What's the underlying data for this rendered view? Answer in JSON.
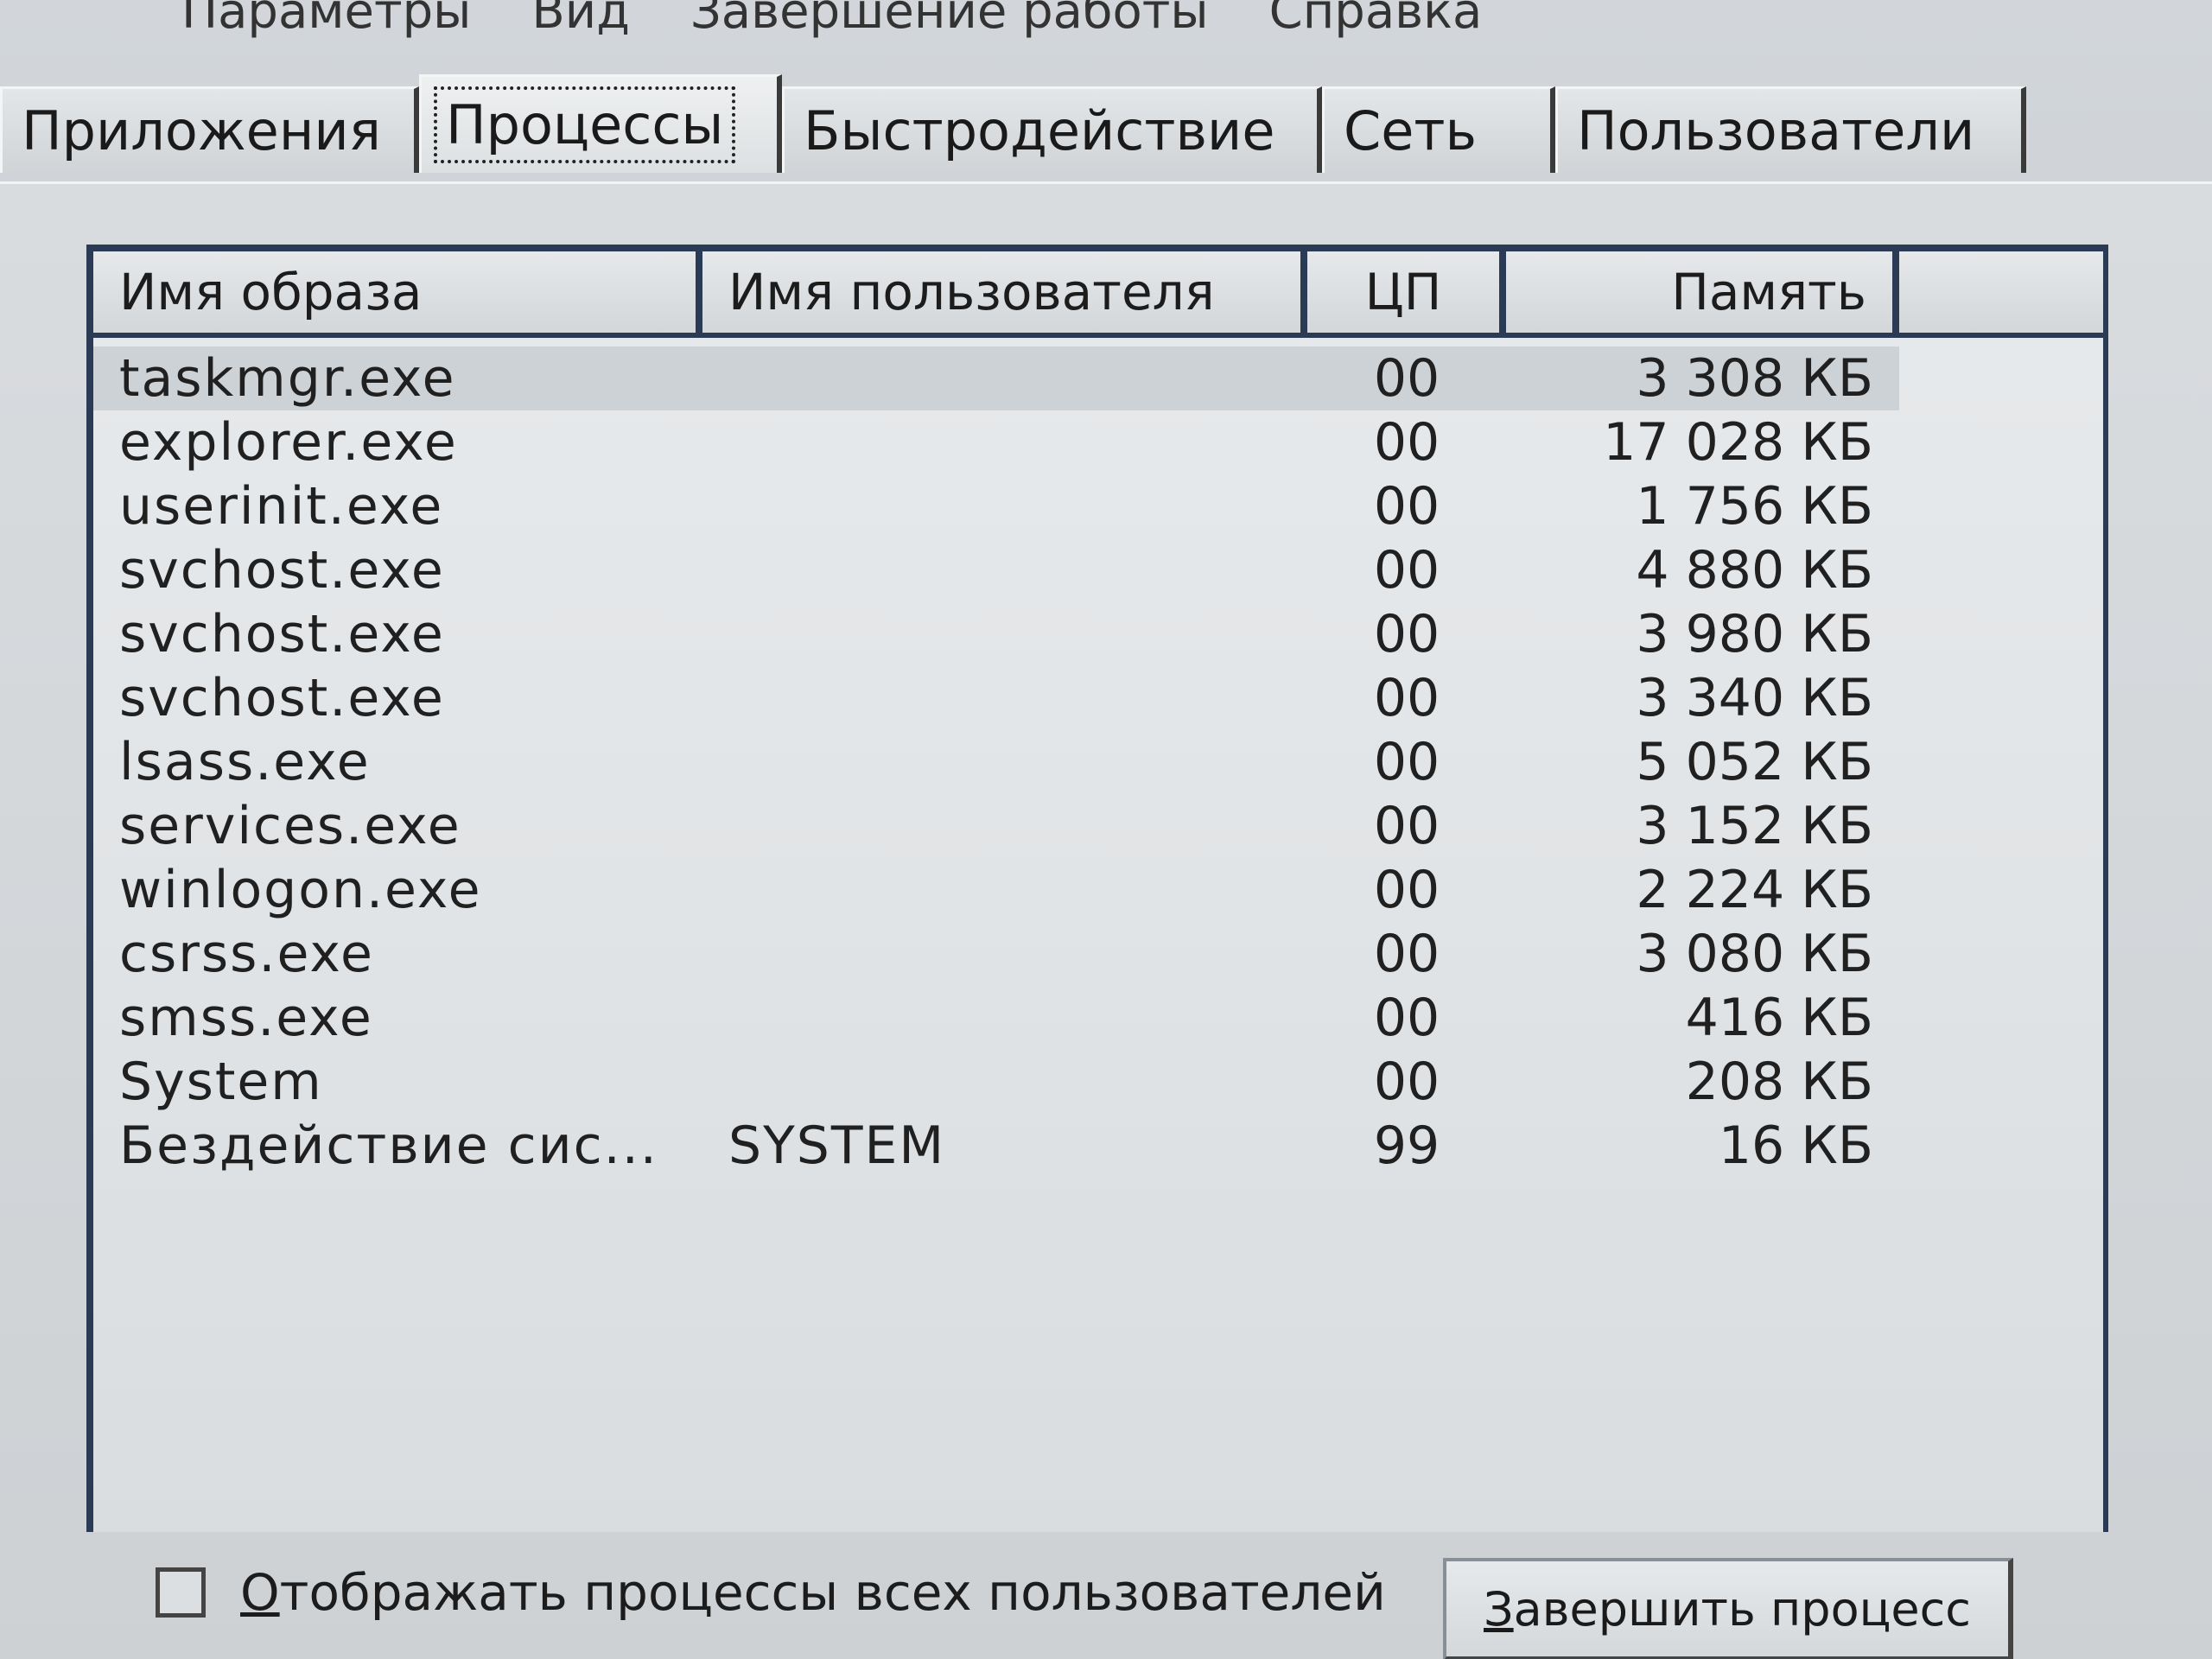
{
  "menu": {
    "items": [
      "Параметры",
      "Вид",
      "Завершение работы",
      "Справка"
    ]
  },
  "tabs": [
    {
      "label": "Приложения",
      "active": false
    },
    {
      "label": "Процессы",
      "active": true
    },
    {
      "label": "Быстродействие",
      "active": false
    },
    {
      "label": "Сеть",
      "active": false
    },
    {
      "label": "Пользователи",
      "active": false
    }
  ],
  "process_list": {
    "columns": {
      "image_name": "Имя образа",
      "user_name": "Имя пользователя",
      "cpu": "ЦП",
      "memory": "Память"
    },
    "rows": [
      {
        "image": "taskmgr.exe",
        "user": "",
        "cpu": "00",
        "memory": "3 308 КБ"
      },
      {
        "image": "explorer.exe",
        "user": "",
        "cpu": "00",
        "memory": "17 028 КБ"
      },
      {
        "image": "userinit.exe",
        "user": "",
        "cpu": "00",
        "memory": "1 756 КБ"
      },
      {
        "image": "svchost.exe",
        "user": "",
        "cpu": "00",
        "memory": "4 880 КБ"
      },
      {
        "image": "svchost.exe",
        "user": "",
        "cpu": "00",
        "memory": "3 980 КБ"
      },
      {
        "image": "svchost.exe",
        "user": "",
        "cpu": "00",
        "memory": "3 340 КБ"
      },
      {
        "image": "lsass.exe",
        "user": "",
        "cpu": "00",
        "memory": "5 052 КБ"
      },
      {
        "image": "services.exe",
        "user": "",
        "cpu": "00",
        "memory": "3 152 КБ"
      },
      {
        "image": "winlogon.exe",
        "user": "",
        "cpu": "00",
        "memory": "2 224 КБ"
      },
      {
        "image": "csrss.exe",
        "user": "",
        "cpu": "00",
        "memory": "3 080 КБ"
      },
      {
        "image": "smss.exe",
        "user": "",
        "cpu": "00",
        "memory": "416 КБ"
      },
      {
        "image": "System",
        "user": "",
        "cpu": "00",
        "memory": "208 КБ"
      },
      {
        "image": "Бездействие сис...",
        "user": "SYSTEM",
        "cpu": "99",
        "memory": "16 КБ"
      }
    ]
  },
  "show_all_processes": {
    "label_accel": "О",
    "label_rest": "тображать процессы всех пользователей",
    "checked": false
  },
  "end_process_button": {
    "label_accel": "З",
    "label_rest": "авершить процесс"
  }
}
